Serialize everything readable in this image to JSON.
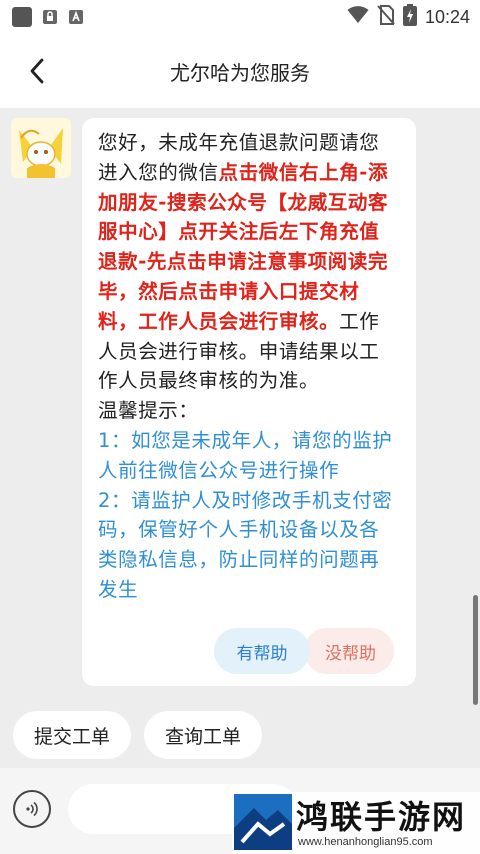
{
  "status_bar": {
    "time": "10:24"
  },
  "header": {
    "title": "尤尔哈为您服务"
  },
  "message": {
    "intro": "您好，未成年充值退款问题请您进入您的微信",
    "highlight": "点击微信右上角-添加朋友-搜索公众号【龙威互动客服中心】点开关注后左下角充值退款-先点击申请注意事项阅读完毕，然后点击申请入口提交材料，工作人员会进行审核。",
    "after": "工作人员会进行审核。申请结果以工作人员最终审核的为准。",
    "tips_title": "温馨提示：",
    "tip1": "1：如您是未成年人，请您的监护人前往微信公众号进行操作",
    "tip2": "2：请监护人及时修改手机支付密码，保管好个人手机设备以及各类隐私信息，防止同样的问题再发生",
    "helpful_label": "有帮助",
    "not_helpful_label": "没帮助"
  },
  "quick_actions": {
    "submit_ticket": "提交工单",
    "query_ticket": "查询工单"
  },
  "input": {
    "placeholder": ""
  },
  "watermark": {
    "title": "鸿联手游网",
    "url": "www.henanhonglian95.com"
  },
  "colors": {
    "highlight": "#e0231a",
    "tip": "#2f8fd6",
    "helpful": "#2a7fcf",
    "not_helpful": "#e07060"
  },
  "icons": [
    "back-arrow-icon",
    "wifi-icon",
    "no-sim-icon",
    "battery-icon",
    "voice-icon",
    "avatar-image"
  ]
}
